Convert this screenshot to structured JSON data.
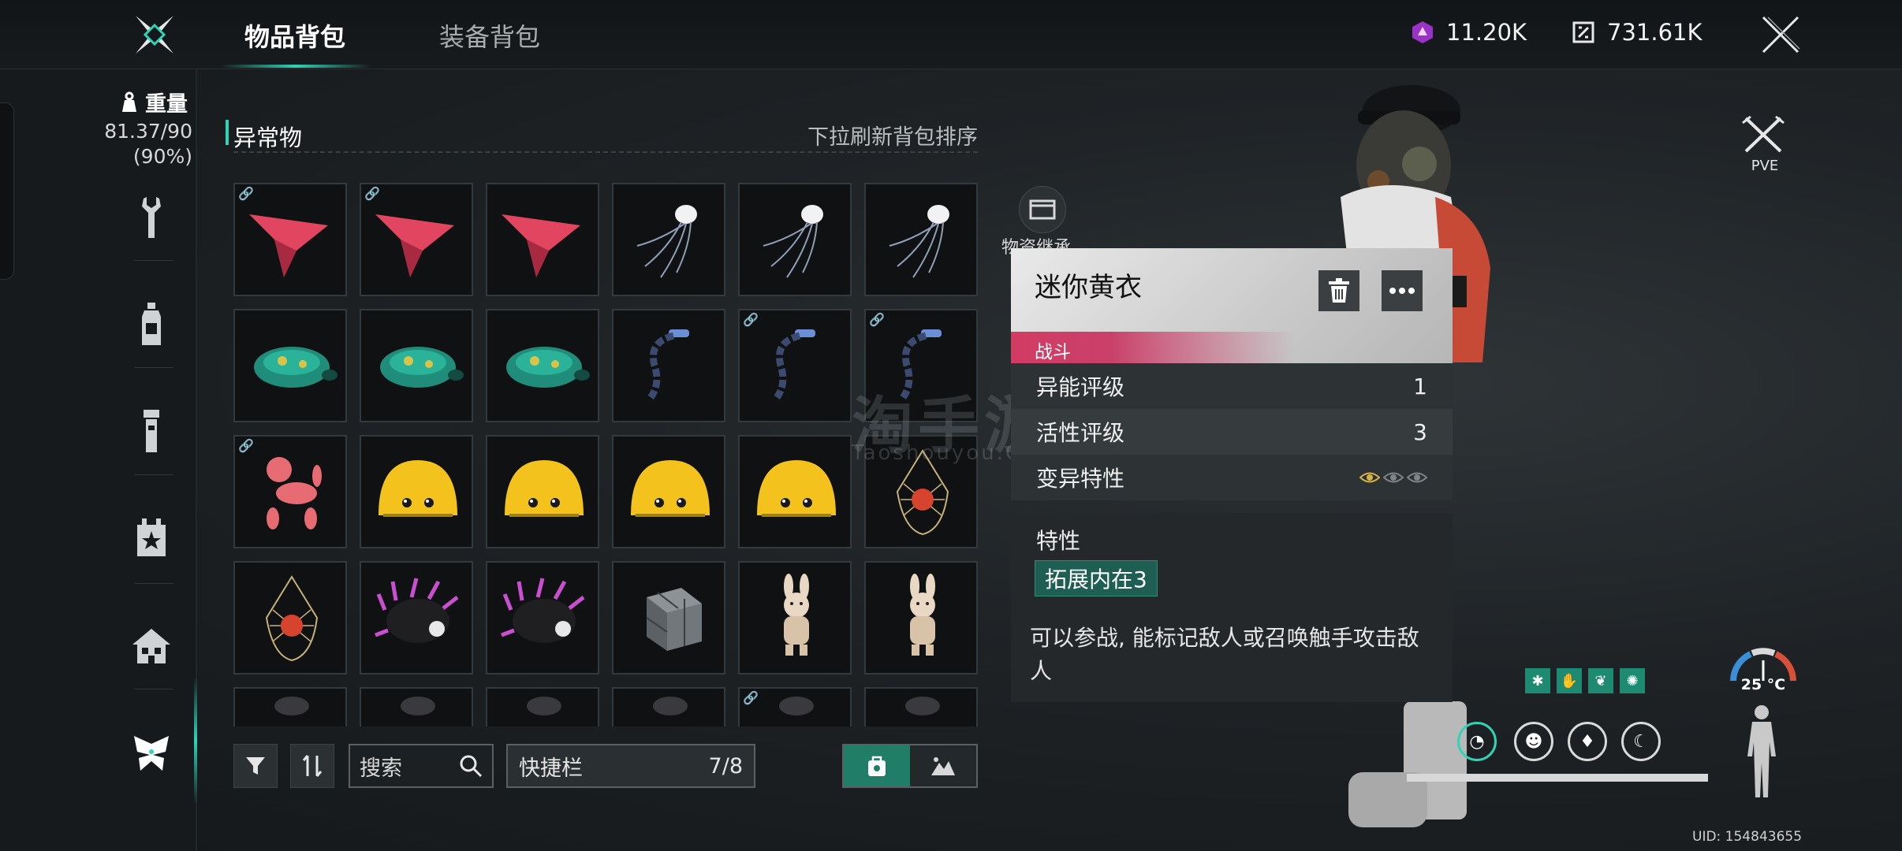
{
  "tabs": [
    {
      "label": "物品背包",
      "active": true
    },
    {
      "label": "装备背包",
      "active": false
    }
  ],
  "currencies": [
    {
      "icon": "purple-crystal-icon",
      "value": "11.20K",
      "color": "#c04adf"
    },
    {
      "icon": "gear-token-icon",
      "value": "731.61K",
      "color": "#e8e8e8"
    }
  ],
  "weight": {
    "label": "重量",
    "value": "81.37/90",
    "percent": "(90%)"
  },
  "rail": [
    {
      "name": "tools",
      "icon": "wrench-icon"
    },
    {
      "name": "consumables",
      "icon": "bottle-icon"
    },
    {
      "name": "materials",
      "icon": "flashlight-icon"
    },
    {
      "name": "favorites",
      "icon": "star-box-icon"
    },
    {
      "name": "housing",
      "icon": "house-icon"
    },
    {
      "name": "deviants",
      "icon": "butterfly-icon"
    }
  ],
  "section": {
    "title": "异常物",
    "hint": "下拉刷新背包排序"
  },
  "items": [
    {
      "kind": "kite",
      "linked": true
    },
    {
      "kind": "kite",
      "linked": true
    },
    {
      "kind": "kite",
      "linked": false
    },
    {
      "kind": "jellyfish",
      "linked": false
    },
    {
      "kind": "jellyfish",
      "linked": false
    },
    {
      "kind": "jellyfish",
      "linked": false
    },
    {
      "kind": "turtle",
      "linked": false
    },
    {
      "kind": "turtle",
      "linked": false
    },
    {
      "kind": "turtle",
      "linked": false
    },
    {
      "kind": "chain",
      "linked": false
    },
    {
      "kind": "chain",
      "linked": true
    },
    {
      "kind": "chain",
      "linked": true
    },
    {
      "kind": "balloon-dog",
      "linked": true
    },
    {
      "kind": "yellow-blob",
      "linked": false
    },
    {
      "kind": "yellow-blob",
      "linked": false
    },
    {
      "kind": "yellow-blob",
      "linked": false
    },
    {
      "kind": "yellow-blob",
      "linked": false
    },
    {
      "kind": "net-bag",
      "linked": false
    },
    {
      "kind": "net-bag",
      "linked": false
    },
    {
      "kind": "spiky",
      "linked": false
    },
    {
      "kind": "spiky",
      "linked": false
    },
    {
      "kind": "cube",
      "linked": false
    },
    {
      "kind": "bunny",
      "linked": false
    },
    {
      "kind": "bunny",
      "linked": false
    },
    {
      "kind": "partial",
      "linked": false
    },
    {
      "kind": "partial",
      "linked": false
    },
    {
      "kind": "partial",
      "linked": false
    },
    {
      "kind": "partial",
      "linked": false
    },
    {
      "kind": "partial",
      "linked": true
    },
    {
      "kind": "partial",
      "linked": false
    }
  ],
  "bottom": {
    "search_label": "搜索",
    "quickbar_label": "快捷栏",
    "quickbar_count": "7/8"
  },
  "materials_label": "物资继承",
  "card": {
    "title": "迷你黄衣",
    "tag": "战斗",
    "rows": [
      {
        "label": "异能评级",
        "value": "1"
      },
      {
        "label": "活性评级",
        "value": "3"
      },
      {
        "label": "变异特性",
        "value": ""
      }
    ],
    "trait_label": "特性",
    "trait_chip": "拓展内在3",
    "description": "可以参战, 能标记敌人或召唤触手攻击敌人",
    "mutation_eyes_filled": 1,
    "mutation_eyes_total": 3
  },
  "watermark": {
    "main": "淘手游",
    "sub": "Taoshouyou.Com"
  },
  "pve_label": "PVE",
  "temperature": "25 °C",
  "uid": "UID: 154843655",
  "status_ring_icons": [
    "stomach-icon",
    "head-icon",
    "water-drop-icon",
    "energy-icon"
  ],
  "status_chip_icons": [
    "bug-icon",
    "hand-icon",
    "plant-icon",
    "spider-icon"
  ],
  "colors": {
    "accent": "#31d3b6",
    "combat_tag": "#d23c63",
    "trait_chip": "#1e5e53"
  }
}
